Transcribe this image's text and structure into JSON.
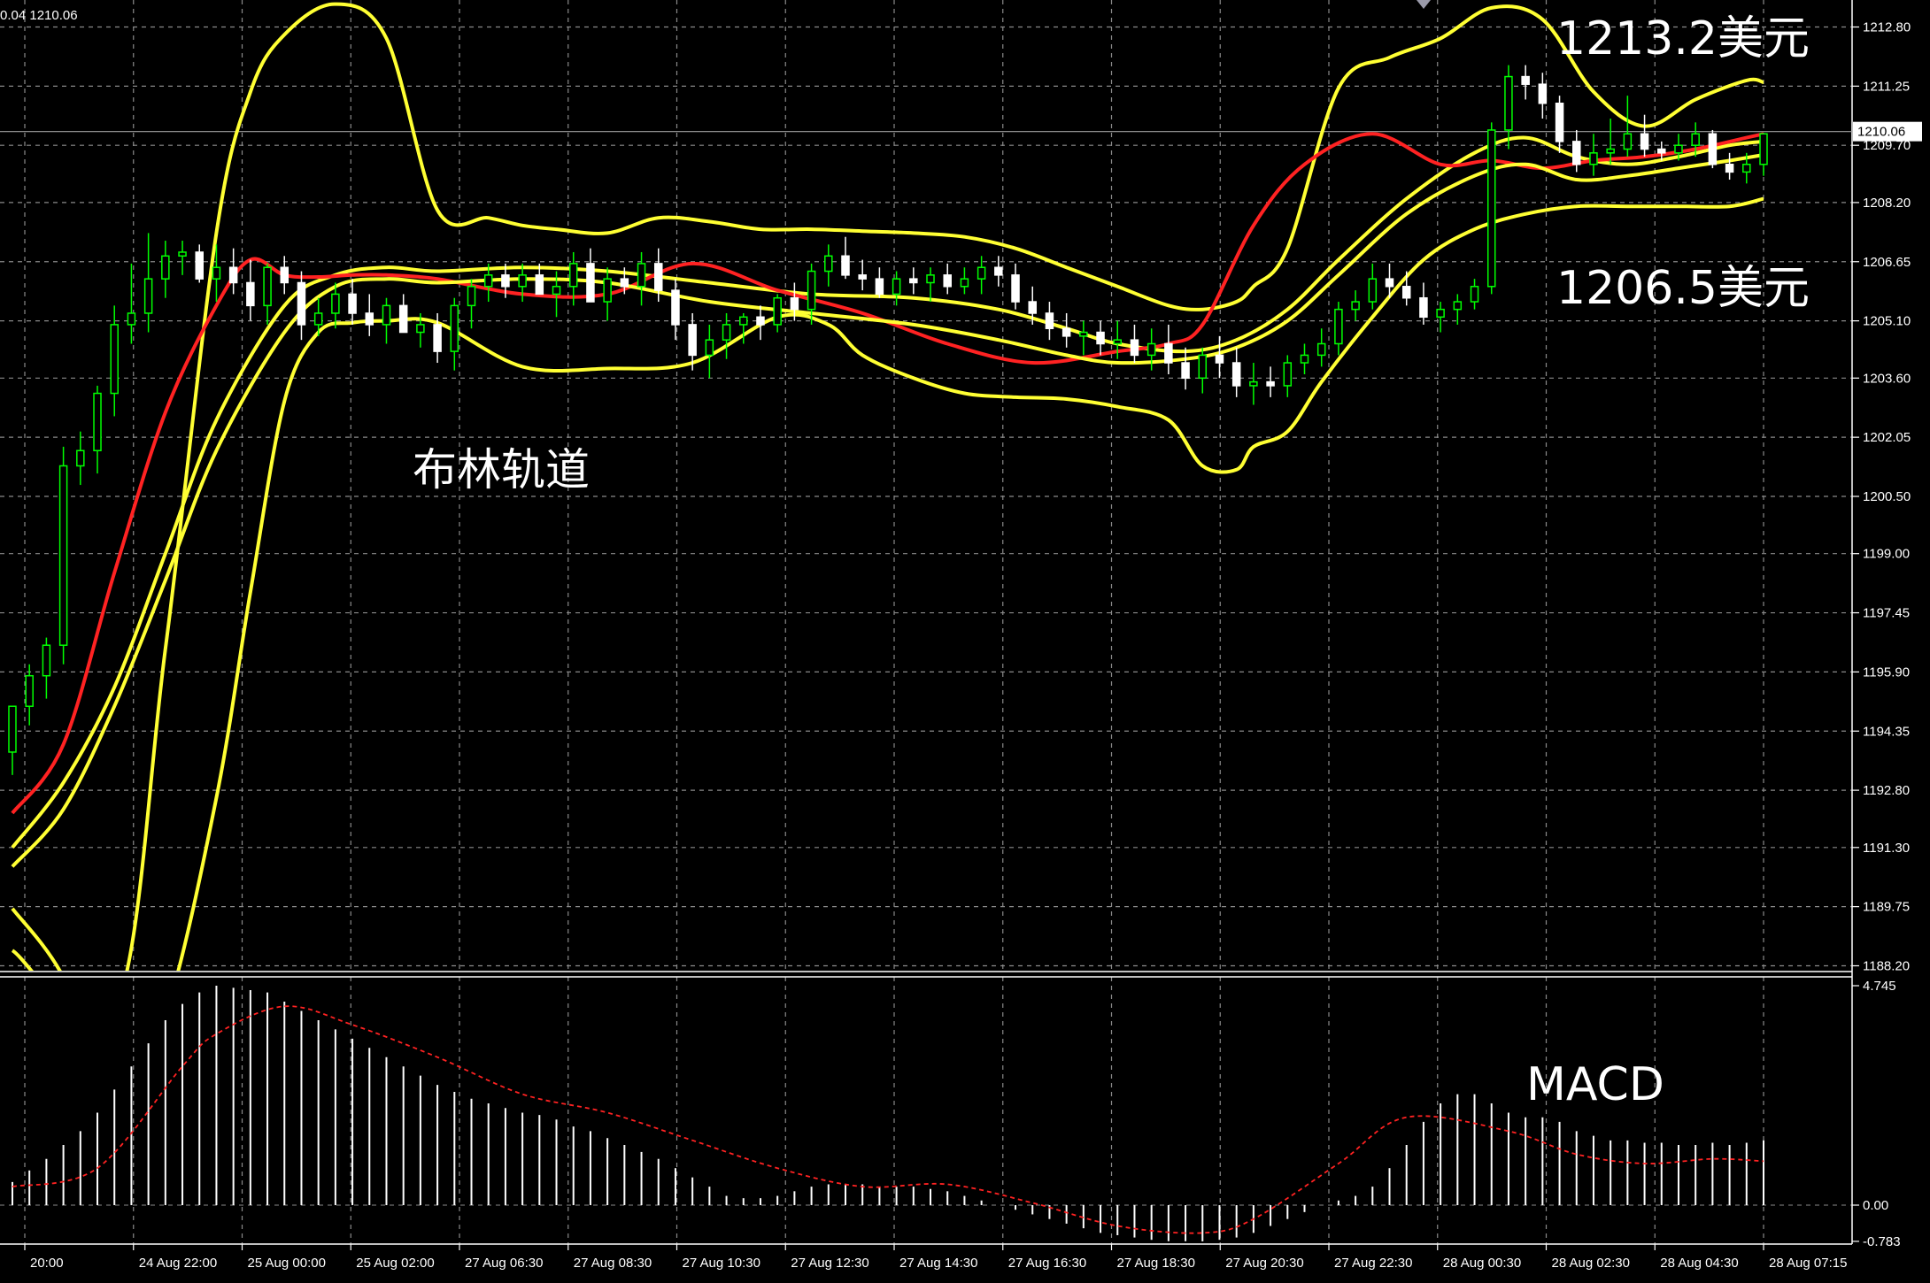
{
  "header": {
    "text": "0.04 1210.06"
  },
  "chart_data": [
    {
      "type": "candlestick",
      "title": "",
      "ylim": [
        1187.9,
        1213.45
      ],
      "y_ticks": [
        "1212.80",
        "1211.25",
        "1209.70",
        "1208.20",
        "1206.65",
        "1205.10",
        "1203.60",
        "1202.05",
        "1200.50",
        "1199.00",
        "1197.45",
        "1195.90",
        "1194.35",
        "1192.80",
        "1191.30",
        "1189.75",
        "1188.20"
      ],
      "current_price": {
        "value": 1210.06,
        "label": "1210.06"
      },
      "x_labels": [
        "20:00",
        "24 Aug 22:00",
        "25 Aug 00:00",
        "25 Aug 02:00",
        "27 Aug 06:30",
        "27 Aug 08:30",
        "27 Aug 10:30",
        "27 Aug 12:30",
        "27 Aug 14:30",
        "27 Aug 16:30",
        "27 Aug 18:30",
        "27 Aug 20:30",
        "27 Aug 22:30",
        "28 Aug 00:30",
        "28 Aug 02:30",
        "28 Aug 04:30",
        "28 Aug 07:15"
      ],
      "annotations": [
        {
          "id": "upper",
          "text": "1213.2美元"
        },
        {
          "id": "lower",
          "text": "1206.5美元"
        },
        {
          "id": "bands",
          "text": "布林轨道"
        }
      ],
      "colors": {
        "up": "#00ff00",
        "down": "#ffffff",
        "band": "#ffff33",
        "ma": "#ff2222",
        "grid": "#8a8a8a",
        "background": "#000000"
      },
      "series": [
        {
          "name": "upper",
          "x": [
            0,
            6,
            9,
            12,
            14,
            16,
            19,
            22,
            25,
            28,
            30,
            32,
            35,
            38,
            41,
            44,
            47,
            50,
            53,
            56,
            59,
            62,
            65,
            68,
            70,
            72,
            73,
            75,
            78,
            81,
            84,
            87,
            90,
            93,
            96,
            99,
            102,
            103
          ],
          "y": [
            1188.6,
            1187.0,
            1196.5,
            1207.4,
            1211.1,
            1212.6,
            1213.4,
            1212.5,
            1208.0,
            1207.8,
            1207.6,
            1207.5,
            1207.4,
            1207.8,
            1207.7,
            1207.5,
            1207.5,
            1207.45,
            1207.4,
            1207.3,
            1207.0,
            1206.5,
            1206.0,
            1205.5,
            1205.4,
            1205.6,
            1206.0,
            1207.0,
            1211.2,
            1212.0,
            1212.5,
            1213.3,
            1213.0,
            1211.1,
            1210.2,
            1210.9,
            1211.4,
            1211.35
          ]
        },
        {
          "name": "upper_mid",
          "x": [
            0,
            3,
            6,
            9,
            12,
            16,
            19,
            22,
            25,
            30,
            35,
            41,
            47,
            53,
            58,
            62,
            65,
            69,
            72,
            75,
            78,
            82,
            86,
            89,
            92,
            95,
            98,
            101,
            103
          ],
          "y": [
            1191.3,
            1193.0,
            1195.5,
            1199.0,
            1202.5,
            1205.5,
            1206.3,
            1206.5,
            1206.4,
            1206.5,
            1206.4,
            1206.1,
            1205.8,
            1205.7,
            1205.4,
            1204.9,
            1204.5,
            1204.3,
            1204.6,
            1205.4,
            1206.7,
            1208.3,
            1209.5,
            1209.9,
            1209.4,
            1209.2,
            1209.4,
            1209.7,
            1209.8
          ]
        },
        {
          "name": "ma",
          "x": [
            0,
            3,
            6,
            9,
            12,
            14,
            16,
            18,
            20,
            22,
            25,
            30,
            35,
            40,
            45,
            50,
            55,
            60,
            65,
            68,
            70,
            73,
            76,
            80,
            84,
            87,
            90,
            93,
            96,
            99,
            102,
            103
          ],
          "y": [
            1192.2,
            1194.0,
            1198.5,
            1202.7,
            1205.5,
            1206.7,
            1206.3,
            1206.25,
            1206.3,
            1206.3,
            1206.2,
            1205.8,
            1205.8,
            1206.6,
            1205.9,
            1205.3,
            1204.5,
            1204.0,
            1204.3,
            1204.5,
            1205.0,
            1207.6,
            1209.2,
            1210.0,
            1209.2,
            1209.3,
            1209.1,
            1209.3,
            1209.4,
            1209.6,
            1209.9,
            1210.0
          ]
        },
        {
          "name": "lower_mid",
          "x": [
            0,
            3,
            6,
            9,
            12,
            16,
            19,
            22,
            25,
            30,
            35,
            41,
            47,
            53,
            58,
            62,
            65,
            69,
            72,
            75,
            78,
            82,
            86,
            89,
            92,
            95,
            98,
            101,
            103
          ],
          "y": [
            1190.8,
            1192.3,
            1195.0,
            1198.3,
            1201.7,
            1204.8,
            1206.0,
            1206.2,
            1206.1,
            1206.2,
            1206.1,
            1205.6,
            1205.3,
            1205.0,
            1204.6,
            1204.2,
            1204.0,
            1204.1,
            1204.4,
            1205.1,
            1206.3,
            1207.9,
            1208.9,
            1209.2,
            1208.8,
            1208.9,
            1209.1,
            1209.3,
            1209.45
          ]
        },
        {
          "name": "lower",
          "x": [
            0,
            3,
            6,
            9,
            12,
            14,
            16,
            18,
            20,
            22,
            25,
            30,
            35,
            40,
            45,
            48,
            50,
            53,
            56,
            59,
            62,
            65,
            68,
            70,
            72,
            73,
            75,
            77,
            80,
            83,
            86,
            89,
            92,
            95,
            98,
            101,
            103
          ],
          "y": [
            1189.7,
            1187.9,
            1184.6,
            1186.9,
            1192.6,
            1198.0,
            1203.0,
            1204.8,
            1205.05,
            1205.1,
            1205.05,
            1203.9,
            1203.85,
            1204.0,
            1205.2,
            1205.0,
            1204.2,
            1203.6,
            1203.2,
            1203.1,
            1203.05,
            1202.85,
            1202.5,
            1201.3,
            1201.2,
            1201.8,
            1202.2,
            1203.5,
            1205.2,
            1206.7,
            1207.5,
            1207.9,
            1208.1,
            1208.1,
            1208.1,
            1208.1,
            1208.3
          ]
        },
        {
          "name": "candles",
          "o": [
            1193.8,
            1195.0,
            1195.8,
            1196.6,
            1201.3,
            1201.7,
            1203.2,
            1205.0,
            1205.3,
            1206.2,
            1206.8,
            1206.9,
            1206.2,
            1206.5,
            1206.1,
            1205.5,
            1206.5,
            1206.1,
            1205.0,
            1205.3,
            1205.8,
            1205.3,
            1205.0,
            1205.5,
            1204.8,
            1205.0,
            1204.3,
            1205.5,
            1206.0,
            1206.3,
            1206.0,
            1206.3,
            1205.8,
            1206.0,
            1206.6,
            1205.6,
            1206.2,
            1206.0,
            1206.6,
            1205.9,
            1205.0,
            1204.2,
            1204.6,
            1205.0,
            1205.2,
            1205.0,
            1205.7,
            1205.4,
            1206.4,
            1206.8,
            1206.3,
            1206.2,
            1205.8,
            1206.2,
            1206.1,
            1206.3,
            1206.0,
            1206.2,
            1206.5,
            1206.3,
            1205.6,
            1205.3,
            1204.9,
            1204.7,
            1204.8,
            1204.5,
            1204.6,
            1204.2,
            1204.5,
            1204.0,
            1203.6,
            1204.2,
            1204.0,
            1203.4,
            1203.5,
            1203.4,
            1204.0,
            1204.2,
            1204.5,
            1205.4,
            1205.6,
            1206.2,
            1206.0,
            1205.7,
            1205.2,
            1205.4,
            1205.6,
            1206.0,
            1210.1,
            1211.5,
            1211.3,
            1210.8,
            1209.8,
            1209.2,
            1209.5,
            1209.6,
            1210.0,
            1209.6,
            1209.5,
            1209.7,
            1210.0,
            1209.2,
            1209.0,
            1209.2
          ],
          "h": [
            1194.8,
            1196.1,
            1196.8,
            1201.8,
            1202.2,
            1203.4,
            1205.5,
            1206.6,
            1207.4,
            1207.2,
            1207.2,
            1207.1,
            1207.1,
            1207.0,
            1206.7,
            1206.6,
            1206.8,
            1206.4,
            1205.7,
            1206.1,
            1206.2,
            1205.8,
            1205.7,
            1205.8,
            1205.3,
            1205.3,
            1205.7,
            1206.2,
            1206.6,
            1206.6,
            1206.6,
            1206.6,
            1206.4,
            1206.9,
            1207.0,
            1206.5,
            1206.5,
            1206.9,
            1207.0,
            1206.2,
            1205.3,
            1205.0,
            1205.3,
            1205.3,
            1205.5,
            1205.8,
            1206.1,
            1206.6,
            1207.1,
            1207.3,
            1206.7,
            1206.5,
            1206.4,
            1206.5,
            1206.5,
            1206.6,
            1206.5,
            1206.8,
            1206.8,
            1206.6,
            1206.0,
            1205.6,
            1205.3,
            1205.1,
            1205.1,
            1205.1,
            1205.0,
            1204.9,
            1205.0,
            1204.4,
            1204.4,
            1204.7,
            1204.4,
            1204.0,
            1203.9,
            1204.2,
            1204.5,
            1204.9,
            1205.6,
            1205.9,
            1206.6,
            1206.6,
            1206.4,
            1206.1,
            1205.6,
            1205.8,
            1206.2,
            1210.3,
            1211.8,
            1211.8,
            1211.6,
            1211.0,
            1210.1,
            1210.0,
            1210.4,
            1211.0,
            1210.5,
            1209.8,
            1210.0,
            1210.3,
            1210.1,
            1209.5,
            1209.5,
            1209.5
          ],
          "l": [
            1193.2,
            1194.5,
            1195.2,
            1196.1,
            1200.8,
            1201.1,
            1202.6,
            1204.5,
            1204.8,
            1205.7,
            1206.3,
            1206.1,
            1205.6,
            1205.8,
            1205.1,
            1205.0,
            1205.8,
            1204.6,
            1204.7,
            1204.9,
            1205.0,
            1204.7,
            1204.5,
            1204.8,
            1204.4,
            1204.0,
            1203.8,
            1204.9,
            1205.6,
            1205.7,
            1205.6,
            1205.8,
            1205.2,
            1205.5,
            1205.9,
            1205.1,
            1205.8,
            1205.5,
            1205.6,
            1204.6,
            1203.8,
            1203.6,
            1204.1,
            1204.5,
            1204.6,
            1204.8,
            1205.1,
            1205.0,
            1206.0,
            1206.2,
            1205.9,
            1205.7,
            1205.5,
            1205.8,
            1205.6,
            1205.8,
            1205.8,
            1205.8,
            1206.0,
            1205.4,
            1205.0,
            1204.6,
            1204.4,
            1204.2,
            1204.2,
            1204.1,
            1204.0,
            1203.8,
            1203.7,
            1203.3,
            1203.2,
            1203.6,
            1203.1,
            1202.9,
            1203.1,
            1203.1,
            1203.7,
            1203.9,
            1204.2,
            1205.1,
            1205.4,
            1205.7,
            1205.5,
            1205.0,
            1204.8,
            1205.0,
            1205.4,
            1205.8,
            1209.6,
            1210.9,
            1210.4,
            1209.5,
            1209.0,
            1208.9,
            1209.2,
            1209.4,
            1209.4,
            1209.3,
            1209.3,
            1209.4,
            1209.1,
            1208.8,
            1208.7,
            1208.9
          ],
          "c": [
            1195.0,
            1195.8,
            1196.6,
            1201.3,
            1201.7,
            1203.2,
            1205.0,
            1205.3,
            1206.2,
            1206.8,
            1206.9,
            1206.2,
            1206.5,
            1206.1,
            1205.5,
            1206.5,
            1206.1,
            1205.0,
            1205.3,
            1205.8,
            1205.3,
            1205.0,
            1205.5,
            1204.8,
            1205.0,
            1204.3,
            1205.5,
            1206.0,
            1206.3,
            1206.0,
            1206.3,
            1205.8,
            1206.0,
            1206.6,
            1205.6,
            1206.2,
            1206.0,
            1206.6,
            1205.9,
            1205.0,
            1204.2,
            1204.6,
            1205.0,
            1205.2,
            1205.0,
            1205.7,
            1205.4,
            1206.4,
            1206.8,
            1206.3,
            1206.2,
            1205.8,
            1206.2,
            1206.1,
            1206.3,
            1206.0,
            1206.2,
            1206.5,
            1206.3,
            1205.6,
            1205.3,
            1204.9,
            1204.7,
            1204.8,
            1204.5,
            1204.6,
            1204.2,
            1204.5,
            1204.0,
            1203.6,
            1204.2,
            1204.0,
            1203.4,
            1203.5,
            1203.4,
            1204.0,
            1204.2,
            1204.5,
            1205.4,
            1205.6,
            1206.2,
            1206.0,
            1205.7,
            1205.2,
            1205.4,
            1205.6,
            1206.0,
            1210.1,
            1211.5,
            1211.3,
            1210.8,
            1209.8,
            1209.2,
            1209.5,
            1209.6,
            1210.0,
            1209.6,
            1209.5,
            1209.7,
            1210.0,
            1209.2,
            1209.0,
            1209.2,
            1210.0
          ]
        }
      ]
    },
    {
      "type": "bar",
      "title": "MACD",
      "ylim": [
        -0.783,
        4.745
      ],
      "y_ticks": [
        "4.745",
        "0.00",
        "-0.783"
      ],
      "colors": {
        "bar": "#ffffff",
        "signal": "#ff2222"
      },
      "series": [
        {
          "name": "histogram",
          "values": [
            0.5,
            0.75,
            1.0,
            1.3,
            1.6,
            2.0,
            2.5,
            3.0,
            3.5,
            4.0,
            4.35,
            4.6,
            4.745,
            4.7,
            4.65,
            4.6,
            4.4,
            4.2,
            4.0,
            3.8,
            3.6,
            3.4,
            3.2,
            3.0,
            2.8,
            2.6,
            2.45,
            2.3,
            2.2,
            2.1,
            2.0,
            1.95,
            1.85,
            1.7,
            1.6,
            1.45,
            1.3,
            1.15,
            1.0,
            0.8,
            0.6,
            0.4,
            0.2,
            0.15,
            0.15,
            0.2,
            0.3,
            0.4,
            0.45,
            0.45,
            0.45,
            0.4,
            0.4,
            0.4,
            0.35,
            0.3,
            0.2,
            0.1,
            0.0,
            -0.1,
            -0.2,
            -0.3,
            -0.4,
            -0.5,
            -0.6,
            -0.65,
            -0.7,
            -0.75,
            -0.78,
            -0.78,
            -0.783,
            -0.75,
            -0.7,
            -0.6,
            -0.45,
            -0.3,
            -0.15,
            0.0,
            0.1,
            0.2,
            0.4,
            0.8,
            1.3,
            1.8,
            2.2,
            2.4,
            2.4,
            2.2,
            2.0,
            1.9,
            1.9,
            1.8,
            1.6,
            1.5,
            1.4,
            1.4,
            1.35,
            1.35,
            1.3,
            1.3,
            1.35,
            1.3,
            1.35,
            1.4
          ]
        },
        {
          "name": "signal",
          "x": [
            0,
            5,
            10,
            12,
            16,
            20,
            25,
            30,
            35,
            40,
            45,
            50,
            55,
            60,
            65,
            70,
            73,
            78,
            82,
            88,
            92,
            96,
            100,
            103
          ],
          "y": [
            0.4,
            0.8,
            3.0,
            3.7,
            4.3,
            3.9,
            3.2,
            2.4,
            2.0,
            1.4,
            0.8,
            0.4,
            0.45,
            0.05,
            -0.45,
            -0.6,
            -0.3,
            0.9,
            1.9,
            1.6,
            1.1,
            0.9,
            1.0,
            0.95
          ]
        }
      ]
    }
  ]
}
